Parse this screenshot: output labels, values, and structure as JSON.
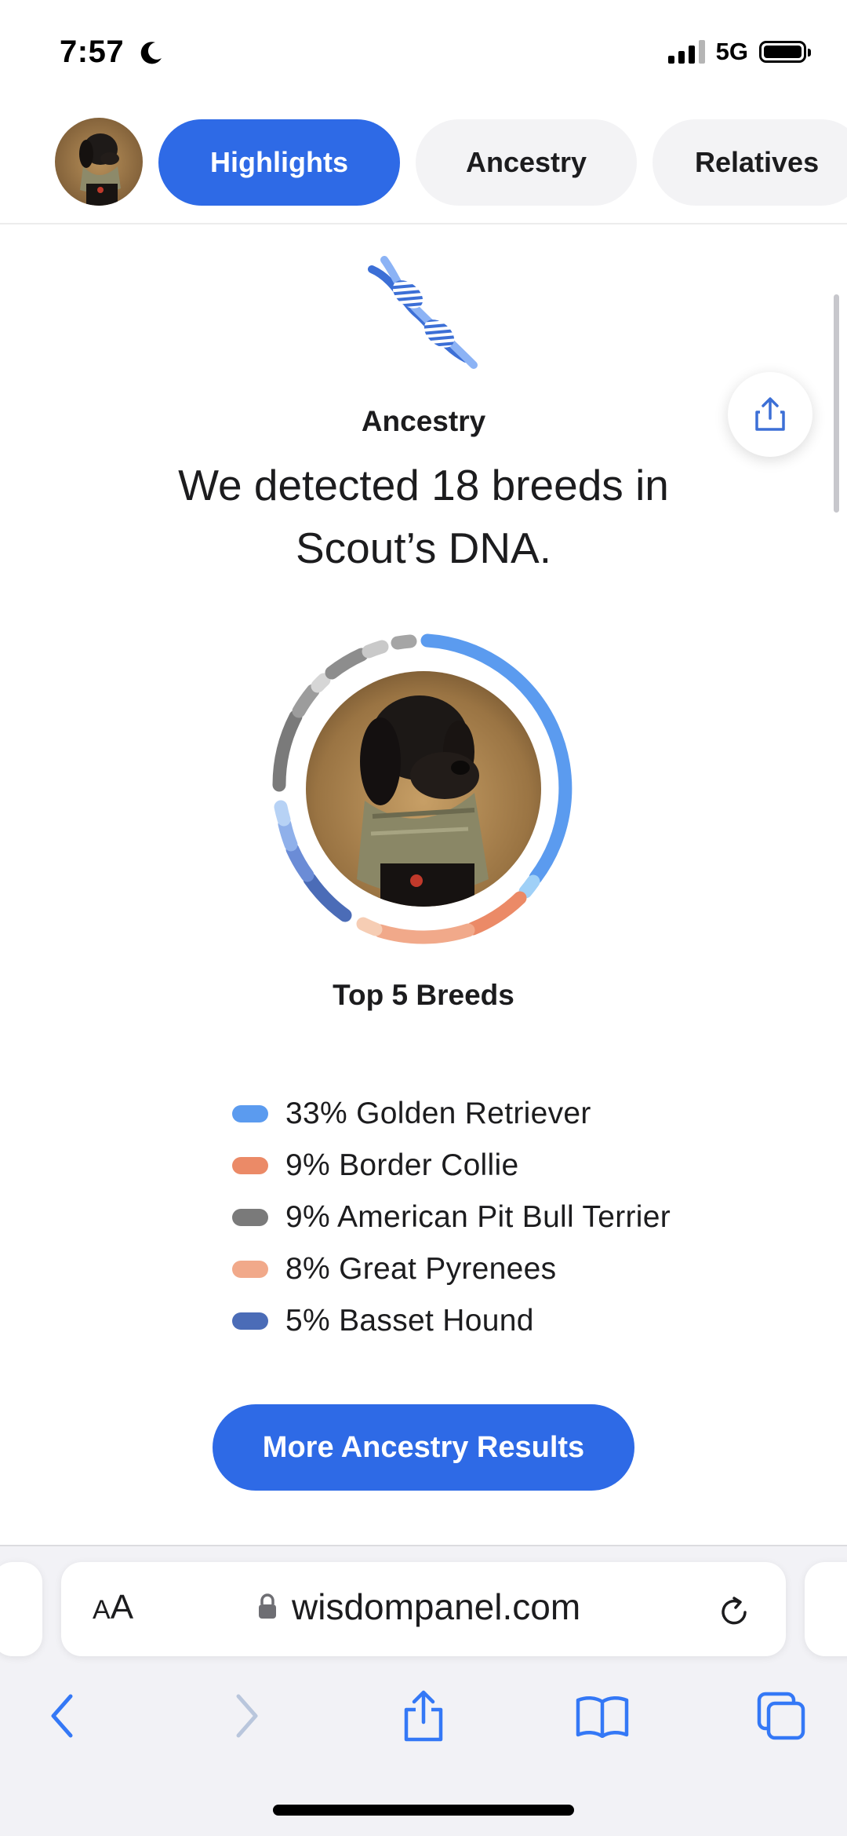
{
  "status_bar": {
    "time": "7:57",
    "network": "5G"
  },
  "tabs": [
    {
      "label": "Highlights",
      "active": true
    },
    {
      "label": "Ancestry",
      "active": false
    },
    {
      "label": "Relatives",
      "active": false
    }
  ],
  "section": {
    "eyebrow": "Ancestry",
    "headline": "We detected 18 breeds in Scout’s DNA."
  },
  "breed_ring": {
    "colors": {
      "golden_retriever": "#5b9bef",
      "border_collie": "#eb8a67",
      "pit_bull": "#7a7a7a",
      "great_pyrenees": "#f1a98a",
      "basset_hound": "#4b6cb7"
    }
  },
  "top_breeds": {
    "title": "Top 5 Breeds",
    "items": [
      {
        "percent": "33%",
        "name": "Golden Retriever",
        "color": "#5b9bef"
      },
      {
        "percent": "9%",
        "name": "Border Collie",
        "color": "#eb8a67"
      },
      {
        "percent": "9%",
        "name": "American Pit Bull Terrier",
        "color": "#7a7a7a"
      },
      {
        "percent": "8%",
        "name": "Great Pyrenees",
        "color": "#f1a98a"
      },
      {
        "percent": "5%",
        "name": "Basset Hound",
        "color": "#4b6cb7"
      }
    ]
  },
  "cta": {
    "label": "More Ancestry Results"
  },
  "browser": {
    "text_size_label_small": "A",
    "text_size_label_large": "A",
    "url": "wisdompanel.com"
  },
  "accent_color": "#2e6ae6"
}
